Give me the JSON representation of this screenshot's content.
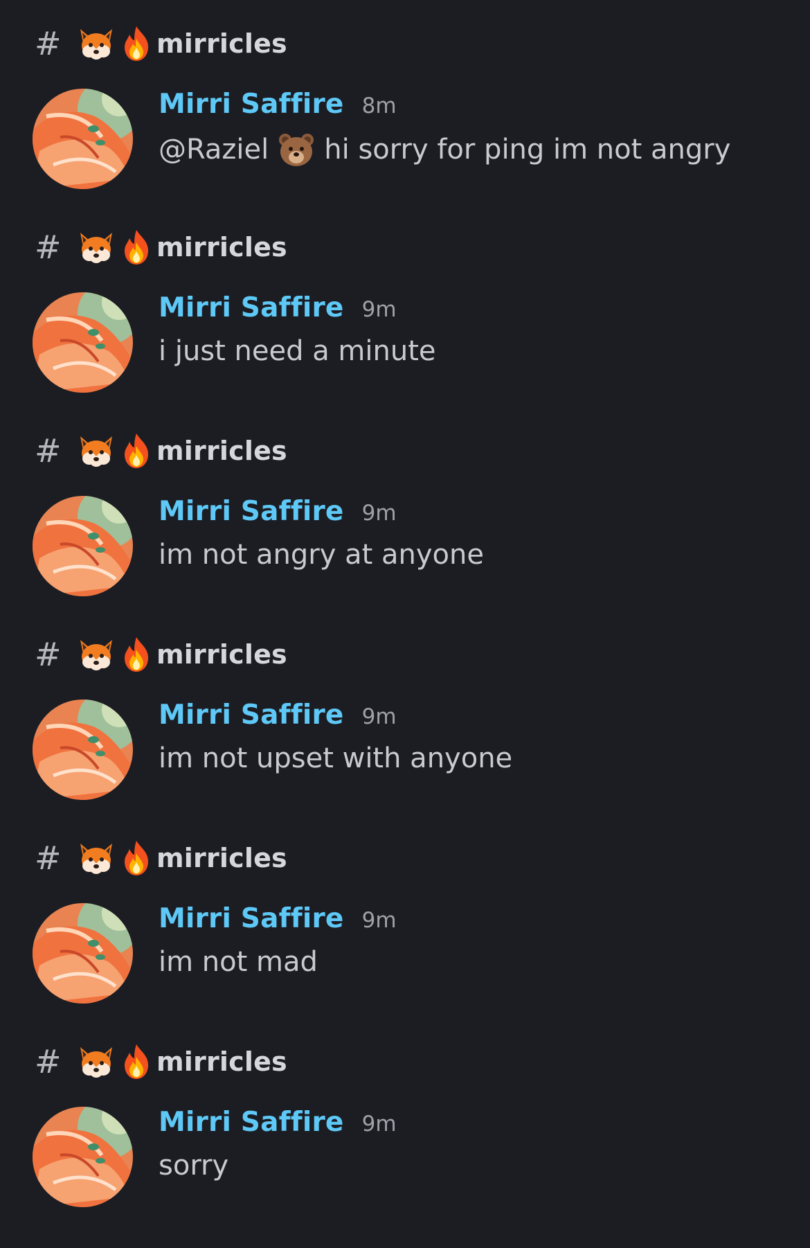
{
  "channel": {
    "prefix": "#",
    "name": "mirricles",
    "emojis": [
      "fox-face-icon",
      "fire-icon"
    ]
  },
  "messages": [
    {
      "channel_name": "mirricles",
      "author": "Mirri Saffire",
      "time": "8m",
      "mention": "@Raziel",
      "mention_emoji": "bear-face-icon",
      "text": "hi sorry for ping im not angry"
    },
    {
      "channel_name": "mirricles",
      "author": "Mirri Saffire",
      "time": "9m",
      "text": "i just need a minute"
    },
    {
      "channel_name": "mirricles",
      "author": "Mirri Saffire",
      "time": "9m",
      "text": "im not angry at anyone"
    },
    {
      "channel_name": "mirricles",
      "author": "Mirri Saffire",
      "time": "9m",
      "text": "im not upset with anyone"
    },
    {
      "channel_name": "mirricles",
      "author": "Mirri Saffire",
      "time": "9m",
      "text": "im not mad"
    },
    {
      "channel_name": "mirricles",
      "author": "Mirri Saffire",
      "time": "9m",
      "text": "sorry"
    }
  ],
  "colors": {
    "background": "#1c1d23",
    "author": "#5ec8f6",
    "text": "#c9cad0",
    "timestamp": "#9ea1a8",
    "channel": "#d6d7db"
  }
}
